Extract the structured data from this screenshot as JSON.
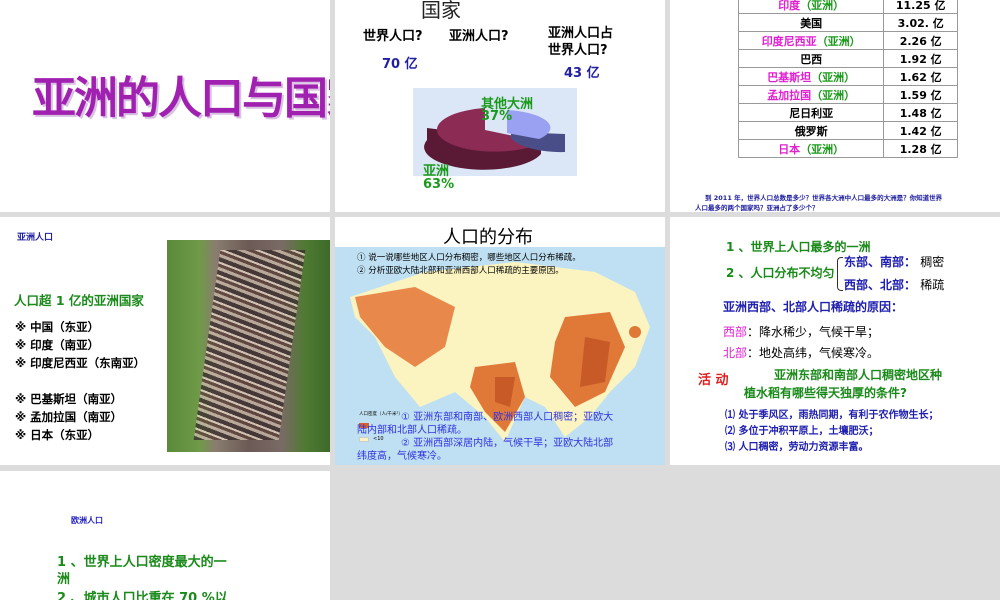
{
  "slide1": {
    "title": "亚洲的人口与国家"
  },
  "slide2": {
    "heading": "国家",
    "q1": "世界人口?",
    "q2": "亚洲人口?",
    "q3a": "亚洲人口占",
    "q3b": "世界人口?",
    "a1": "70 亿",
    "a3": "43 亿",
    "chart_data": {
      "type": "pie",
      "title": "",
      "categories": [
        "亚洲",
        "其他大洲"
      ],
      "values": [
        63,
        37
      ],
      "labels": [
        {
          "name": "其他大洲",
          "pct": "37%"
        },
        {
          "name": "亚洲",
          "pct": "63%"
        }
      ]
    }
  },
  "slide3": {
    "rows": [
      {
        "country": "印度",
        "tag": "（亚洲）",
        "asia": true,
        "pop": "11.25 亿"
      },
      {
        "country": "美国",
        "tag": "",
        "asia": false,
        "pop": "3.02. 亿"
      },
      {
        "country": "印度尼西亚",
        "tag": "（亚洲）",
        "asia": true,
        "pop": "2.26 亿"
      },
      {
        "country": "巴西",
        "tag": "",
        "asia": false,
        "pop": "1.92 亿"
      },
      {
        "country": "巴基斯坦",
        "tag": "（亚洲）",
        "asia": true,
        "pop": "1.62 亿"
      },
      {
        "country": "孟加拉国",
        "tag": "（亚洲）",
        "asia": true,
        "pop": "1.59 亿"
      },
      {
        "country": "尼日利亚",
        "tag": "",
        "asia": false,
        "pop": "1.48 亿"
      },
      {
        "country": "俄罗斯",
        "tag": "",
        "asia": false,
        "pop": "1.42 亿"
      },
      {
        "country": "日本",
        "tag": "（亚洲）",
        "asia": true,
        "pop": "1.28 亿"
      }
    ],
    "note1": "到 2011 年，世界人口总数是多少？世界各大洲中人口最多的大洲是？你知道世界",
    "note2": "人口最多的两个国家吗？亚洲占了多少个？"
  },
  "slide4": {
    "label": "亚洲人口",
    "heading": "人口超 1 亿的亚洲国家",
    "items": [
      "※ 中国（东亚）",
      "※ 印度（南亚）",
      "※ 印度尼西亚（东南亚）",
      "※ 巴基斯坦（南亚）",
      "※ 孟加拉国（南亚）",
      "※ 日本（东亚）"
    ]
  },
  "slide5": {
    "title": "人口的分布",
    "q1": "① 说一说哪些地区人口分布稠密，哪些地区人口分布稀疏。",
    "q2": "② 分析亚欧大陆北部和亚洲西部人口稀疏的主要原因。",
    "a1a": "①  亚洲东部和南部、欧洲西部人口稠密；亚欧大",
    "a1b": "陆内部和北部人口稀疏。",
    "a2a": "②  亚洲西部深居内陆，气候干旱；亚欧大陆北部",
    "a2b": "纬度高，气候寒冷。",
    "legend": "人口密度（人/千米²）",
    "legend_low": "<10"
  },
  "slide6": {
    "p1": "1 、世界上人口最多的一洲",
    "p2": "2 、人口分布不均匀",
    "east": "东部、南部：",
    "dense": "稠密",
    "west": "西部、北部：",
    "sparse": "稀疏",
    "reason": "亚洲西部、北部人口稀疏的原因：",
    "w_lbl": "西部",
    "w_txt": "：降水稀少，气候干旱；",
    "n_lbl": "北部",
    "n_txt": "：地处高纬，气候寒冷。",
    "act": "活 动",
    "q1": "亚洲东部和南部人口稠密地区种",
    "q2": "植水稻有哪些得天独厚的条件?",
    "r1": "⑴ 处于季风区，雨热同期，有利于农作物生长；",
    "r2": "⑵ 多位于冲积平原上，土壤肥沃；",
    "r3": "⑶ 人口稠密，劳动力资源丰富。"
  },
  "slide7": {
    "label": "欧洲人口",
    "p1a": "1 、世界上人口密度最大的一",
    "p1b": "洲",
    "p2": "2 、城市人口比重在 70 %以"
  }
}
